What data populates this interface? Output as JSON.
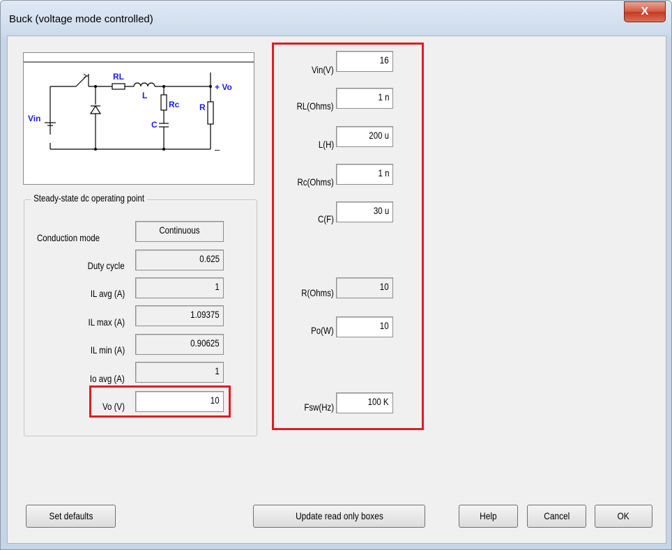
{
  "window": {
    "title": "Buck (voltage mode controlled)",
    "close_glyph": "X"
  },
  "schematic": {
    "labels": {
      "rl": "RL",
      "l": "L",
      "vo": "+ Vo",
      "vin": "Vin",
      "rc": "Rc",
      "r": "R",
      "c": "C",
      "minus": "–"
    },
    "label_color": "#1a1aee"
  },
  "steady_state": {
    "title": "Steady-state dc operating point",
    "rows": [
      {
        "label": "Conduction mode",
        "value": "Continuous"
      },
      {
        "label": "Duty cycle",
        "value": "0.625"
      },
      {
        "label": "IL avg (A)",
        "value": "1"
      },
      {
        "label": "IL max (A)",
        "value": "1.09375"
      },
      {
        "label": "IL min (A)",
        "value": "0.90625"
      },
      {
        "label": "Io avg (A)",
        "value": "1"
      },
      {
        "label": "Vo (V)",
        "value": "10"
      }
    ]
  },
  "params": [
    {
      "label": "Vin(V)",
      "value": "16"
    },
    {
      "label": "RL(Ohms)",
      "value": "1 n"
    },
    {
      "label": "L(H)",
      "value": "200 u"
    },
    {
      "label": "Rc(Ohms)",
      "value": "1 n"
    },
    {
      "label": "C(F)",
      "value": "30 u"
    },
    {
      "label": "R(Ohms)",
      "value": "10"
    },
    {
      "label": "Po(W)",
      "value": "10"
    },
    {
      "label": "Fsw(Hz)",
      "value": "100 K"
    }
  ],
  "buttons": {
    "set_defaults": "Set defaults",
    "update": "Update read only boxes",
    "help": "Help",
    "cancel": "Cancel",
    "ok": "OK"
  },
  "highlight_color": "#e01c24"
}
